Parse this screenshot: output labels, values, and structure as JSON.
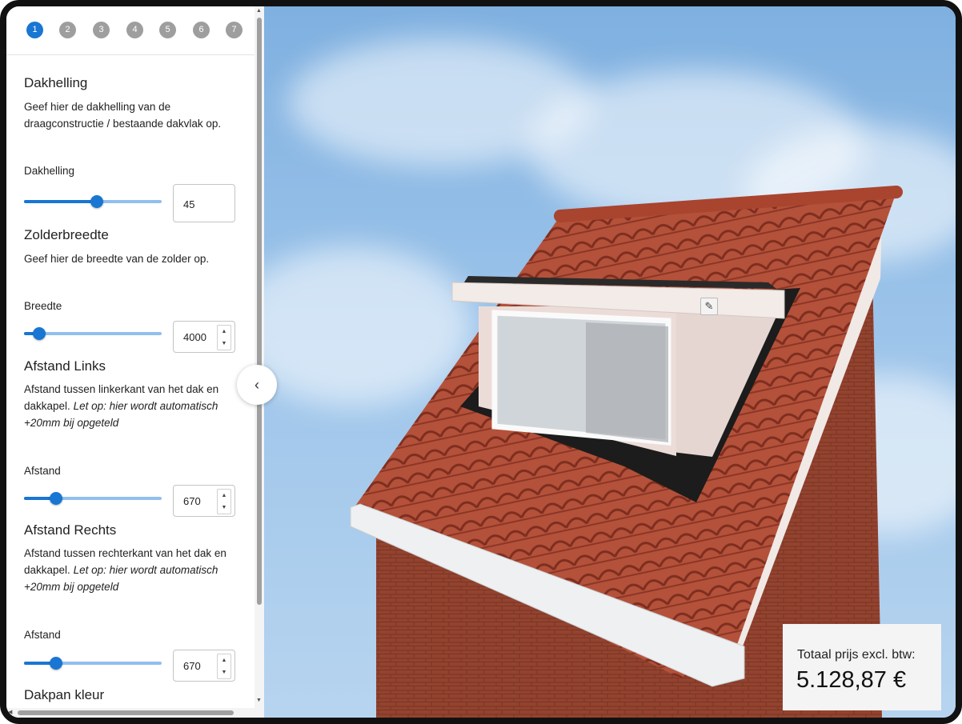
{
  "steps": [
    "1",
    "2",
    "3",
    "4",
    "5",
    "6",
    "7"
  ],
  "active_step": 0,
  "sections": {
    "dakhelling": {
      "title": "Dakhelling",
      "description": "Geef hier de dakhelling van de draagconstructie / bestaande dakvlak op.",
      "field_label": "Dakhelling",
      "value": "45",
      "slider_fraction": 0.53
    },
    "zolderbreedte": {
      "title": "Zolderbreedte",
      "description": "Geef hier de breedte van de zolder op.",
      "field_label": "Breedte",
      "value": "4000",
      "slider_fraction": 0.11
    },
    "afstand_links": {
      "title": "Afstand Links",
      "description": "Afstand tussen linkerkant van het dak en dakkapel.",
      "note": "Let op: hier wordt automatisch +20mm bij opgeteld",
      "field_label": "Afstand",
      "value": "670",
      "slider_fraction": 0.23
    },
    "afstand_rechts": {
      "title": "Afstand Rechts",
      "description": "Afstand tussen rechterkant van het dak en dakkapel.",
      "note": "Let op: hier wordt automatisch +20mm bij opgeteld",
      "field_label": "Afstand",
      "value": "670",
      "slider_fraction": 0.23
    },
    "dakpan_kleur": {
      "title": "Dakpan kleur"
    }
  },
  "price": {
    "label": "Totaal prijs excl. btw:",
    "value": "5.128,87 €"
  },
  "icons": {
    "collapse": "chevron-left-icon",
    "edit": "pencil-icon",
    "spin_up": "arrow-up-icon",
    "spin_down": "arrow-down-icon"
  },
  "colors": {
    "accent": "#1976d2",
    "step_inactive": "#9e9e9e",
    "slider_rail": "#90bff0",
    "sky": "#9cc4ea",
    "roof_tile": "#b5523a",
    "brick": "#9c4a38"
  }
}
